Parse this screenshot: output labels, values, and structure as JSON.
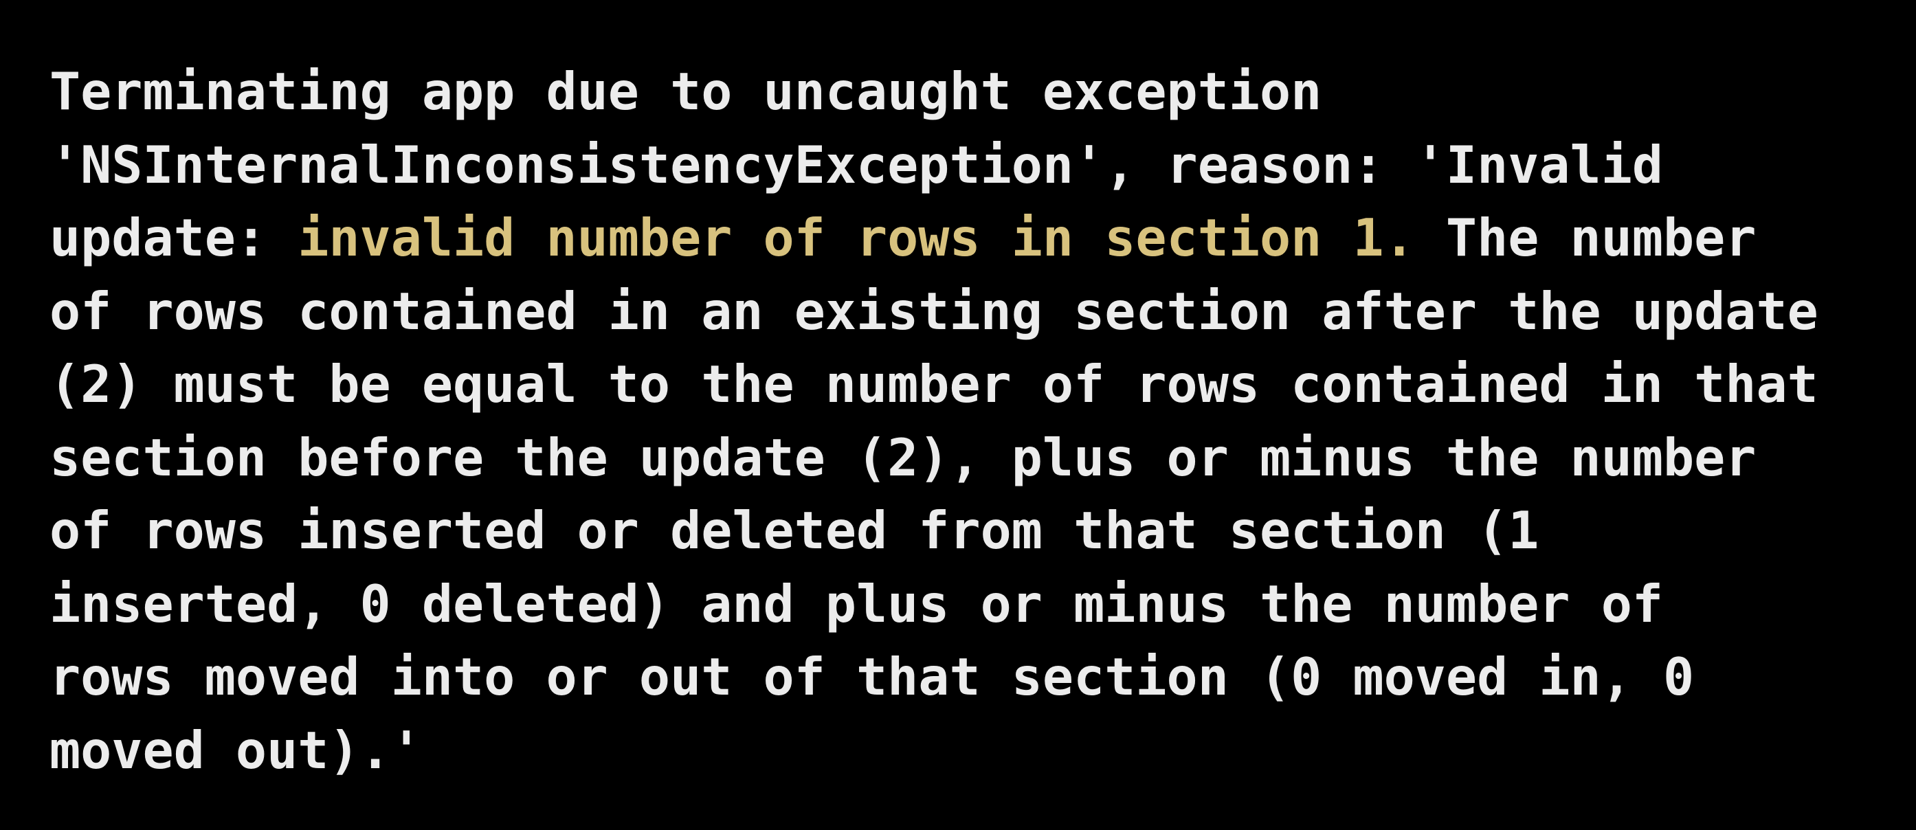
{
  "colors": {
    "background": "#000000",
    "text": "#ececec",
    "highlight": "#d8c27e"
  },
  "message": {
    "line1": "Terminating app due to uncaught exception",
    "line2": "'NSInternalInconsistencyException', reason: 'Invalid",
    "line3_pre": "update: ",
    "line3_highlight": "invalid number of rows in section 1.",
    "line3_post": " The number",
    "line4": "of rows contained in an existing section after the update",
    "line5": "(2) must be equal to the number of rows contained in that",
    "line6": "section before the update (2), plus or minus the number",
    "line7": "of rows inserted or deleted from that section (1",
    "line8": "inserted, 0 deleted) and plus or minus the number of",
    "line9": "rows moved into or out of that section (0 moved in, 0",
    "line10": "moved out).'"
  }
}
